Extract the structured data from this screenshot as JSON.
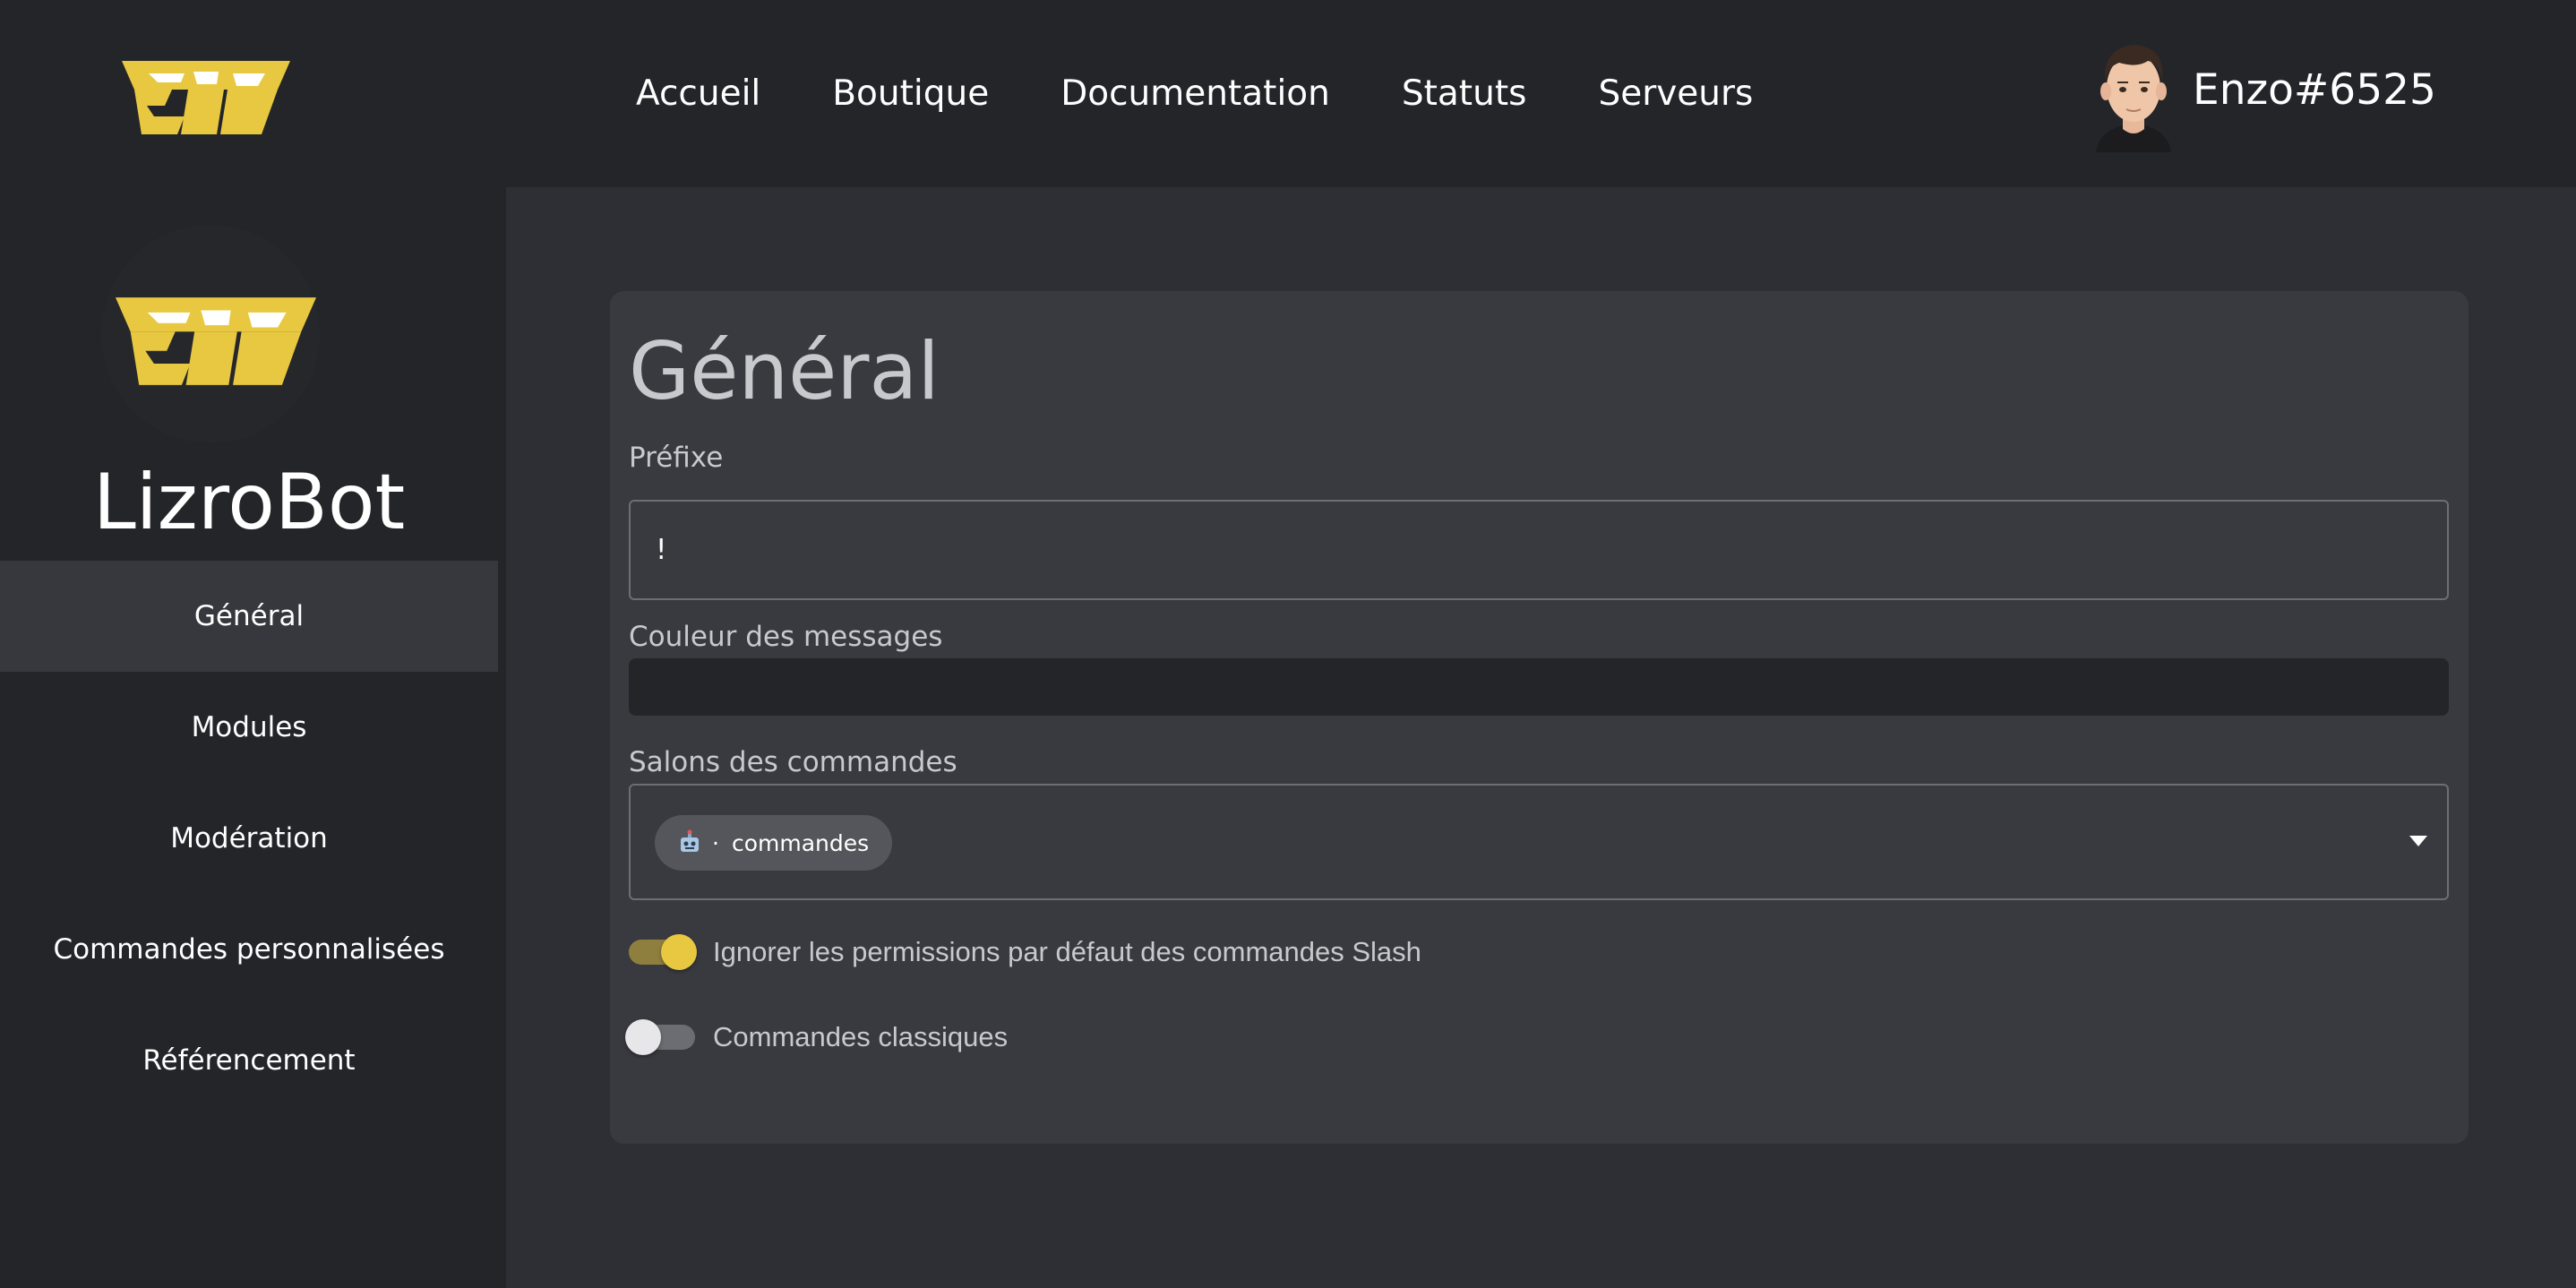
{
  "colors": {
    "accent": "#e8c840",
    "background": "#242529",
    "main_background": "#2e2f34",
    "card_background": "#393a40",
    "active_sidebar_item": "#37383d"
  },
  "header": {
    "logo_icon": "lizrobot-logo",
    "nav_items": [
      "Accueil",
      "Boutique",
      "Documentation",
      "Statuts",
      "Serveurs"
    ],
    "user": {
      "avatar_icon": "user-avatar",
      "name": "Enzo#6525"
    }
  },
  "sidebar": {
    "logo_icon": "lizrobot-logo",
    "bot_name": "LizroBot",
    "items": [
      {
        "label": "Général",
        "active": true
      },
      {
        "label": "Modules",
        "active": false
      },
      {
        "label": "Modération",
        "active": false
      },
      {
        "label": "Commandes personnalisées",
        "active": false
      },
      {
        "label": "Référencement",
        "active": false
      }
    ]
  },
  "main": {
    "title": "Général",
    "prefix": {
      "label": "Préfixe",
      "value": "!"
    },
    "message_color": {
      "label": "Couleur des messages"
    },
    "command_channels": {
      "label": "Salons des commandes",
      "selected": [
        {
          "icon": "robot-icon",
          "separator": "·",
          "name": "commandes"
        }
      ]
    },
    "toggles": [
      {
        "label": "Ignorer les permissions par défaut des commandes Slash",
        "on": true
      },
      {
        "label": "Commandes classiques",
        "on": false
      }
    ]
  }
}
